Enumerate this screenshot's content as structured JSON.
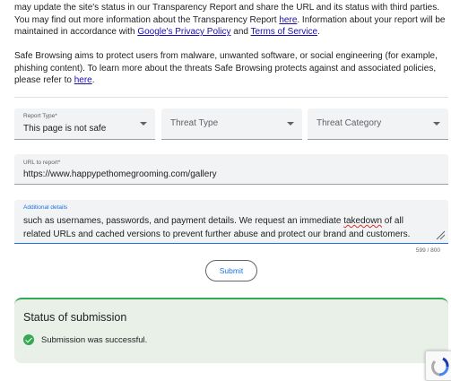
{
  "intro": {
    "para1_a": "may update the site's status in our Transparency Report and share the URL and its status with third parties. You may find out more information about the Transparency Report ",
    "para1_link1": "here",
    "para1_b": ". Information about your report will be maintained in accordance with ",
    "para1_link2": "Google's Privacy Policy",
    "para1_c": " and ",
    "para1_link3": "Terms of Service",
    "para1_d": ".",
    "para2_a": "Safe Browsing aims to protect users from malware, unwanted software, or social engineering (for example, phishing content). To learn more about the threats Safe Browsing protects against and associated policies, please refer to ",
    "para2_link": "here",
    "para2_b": "."
  },
  "form": {
    "report_type": {
      "label": "Report Type*",
      "value": "This page is not safe"
    },
    "threat_type": {
      "placeholder": "Threat Type"
    },
    "threat_category": {
      "placeholder": "Threat Category"
    },
    "url": {
      "label": "URL to report*",
      "value": "https://www.happypethomegrooming.com/gallery"
    },
    "details": {
      "label": "Additional details",
      "text_a": "such as usernames, passwords, and payment details. We request an immediate ",
      "text_misspelled": "takedown",
      "text_b": " of all related URLs and cached versions to prevent further abuse and protect our brand and customers."
    },
    "counter": "599 / 800",
    "submit_label": "Submit"
  },
  "status": {
    "title": "Status of submission",
    "message": "Submission was successful."
  },
  "colors": {
    "accent": "#1a73e8",
    "success": "#34a853",
    "link": "#1a0dab"
  }
}
